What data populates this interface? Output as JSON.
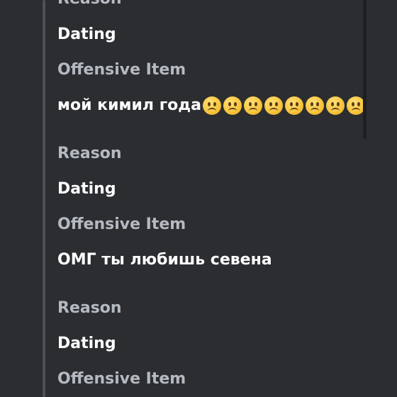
{
  "entries": [
    {
      "reason_label": "Reason",
      "reason_value": "Dating",
      "offensive_label": "Offensive Item",
      "offensive_value": "мой кимил года",
      "emoji": "frowning-face",
      "emoji_count": 8
    },
    {
      "reason_label": "Reason",
      "reason_value": "Dating",
      "offensive_label": "Offensive Item",
      "offensive_value": "ОМГ ты любишь севена"
    },
    {
      "reason_label": "Reason",
      "reason_value": "Dating",
      "offensive_label": "Offensive Item"
    }
  ],
  "colors": {
    "background": "#2b2d31",
    "label": "#b5bac1",
    "value": "#ffffff",
    "accent_bar": "#4e5058",
    "scrollbar_thumb": "#1e1f22"
  }
}
